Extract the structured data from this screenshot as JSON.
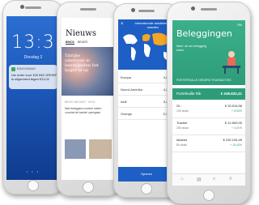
{
  "lock_screen": {
    "time": "13:3",
    "date": "Dinsdag 2",
    "notification": {
      "app": "BINCKBANK",
      "text": "Uw order voor 100 ING GROEP is uitgevoerd tegen €11,02"
    },
    "page_dots": "• • •"
  },
  "news": {
    "title": "Nieuws",
    "tabs": [
      "BINCK",
      "BEURS"
    ],
    "headline": "Talrijke uitstroom in beurs buiten het hoger te op",
    "meta": "BINCK NIEUWS · 09:31",
    "body": "Wat beleggers moeten weten voordat de handel opengaat."
  },
  "markets": {
    "close": "×",
    "title": "Internationale aandelen en waarden",
    "rows": [
      {
        "label": "Europa",
        "value": "4,23%"
      },
      {
        "label": "Noord-Amerika",
        "value": "4,23%"
      },
      {
        "label": "Azië",
        "value": "3,27%"
      },
      {
        "label": "Overige",
        "value": "0,31%"
      }
    ],
    "button": "Openen"
  },
  "investments": {
    "tag": "Rik",
    "title": "Beleggingen",
    "subtitle": "Meer uit uw belegging halen",
    "tabs": "PORTEFEUILLE   ORDERS   TRANSACTIES",
    "total_label": "Portefeuille  Rik",
    "total_value": "€ 246.632,41",
    "rows": [
      {
        "name": "Gr...",
        "qty": "100 stuks",
        "value": "€ 33.516,58",
        "change": "+ 8,53%"
      },
      {
        "name": "Tracker",
        "qty": "250 stuks",
        "value": "€ 12.500,00",
        "change": "+ 3,01%"
      },
      {
        "name": "Ishares",
        "qty": "80 stuks",
        "value": "€ 232.194,45",
        "change": "+ 10,42%"
      }
    ]
  }
}
